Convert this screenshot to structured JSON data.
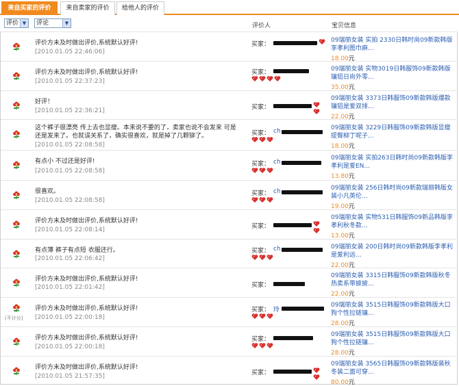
{
  "tabs": [
    {
      "label": "来自买家的评价",
      "active": true
    },
    {
      "label": "来自卖家的评价",
      "active": false
    },
    {
      "label": "给他人的评价",
      "active": false
    }
  ],
  "filters": {
    "rating_select": "评价",
    "comment_select": "评论"
  },
  "columns": {
    "reviewer": "评价人",
    "item": "宝贝信息"
  },
  "buyer_label": "买家：",
  "currency_unit": "元",
  "not_counted_label": "[不计分]",
  "colors": {
    "accent": "#f08a1e",
    "link": "#2a5db0",
    "heart": "#d8312f",
    "flower": "#d8312f",
    "stem": "#2e8b2e"
  },
  "rows": [
    {
      "comment": "评价方未及时做出评价,系统默认好评!",
      "date": "[2010.01.05 22:46:06]",
      "reviewer_prefix": "",
      "heart_count": 1,
      "item": "09瑞丽女装 实拍 2330日韩时尚09新款韩版李孝利图巾麻...",
      "price": "18.00"
    },
    {
      "comment": "评价方未及时做出评价,系统默认好评!",
      "date": "[2010.01.05 22:37:23]",
      "reviewer_prefix": "",
      "heart_count": 4,
      "item": "09瑞丽女装 实物3019日韩服饰09新款韩版镶铝日尚外零...",
      "price": "35.00"
    },
    {
      "comment": "好评！",
      "date": "[2010.01.05 22:36:21]",
      "reviewer_prefix": "",
      "heart_count": 2,
      "item": "09瑞丽女装 3373日韩服饰09新款韩版爆款镶铝是爱双排...",
      "price": "22.00"
    },
    {
      "comment": "这个裤子很漂亮 传上去也显瘦。本来说不要的了，卖家也说不会发来 可是还是发来了。也就误关系了，确实很喜欢，就是掉了几颗铆了。",
      "date": "[2010.01.05 22:08:58]",
      "reviewer_prefix": "ch",
      "heart_count": 3,
      "item": "09瑞丽女装 3229日韩服饰09新款韩版显瘦提臀柳丁呢子...",
      "price": "18.00"
    },
    {
      "comment": "有点小 不过还是好评!",
      "date": "[2010.01.05 22:08:58]",
      "reviewer_prefix": "ch",
      "heart_count": 3,
      "item": "09瑞丽女装 实拍263日韩时尚09新款韩版李孝利是爱EN...",
      "price": "13.80"
    },
    {
      "comment": "很喜欢。",
      "date": "[2010.01.05 22:08:58]",
      "reviewer_prefix": "ch",
      "heart_count": 3,
      "item": "09瑞丽女装 256日韩时尚09新款瑞丽韩版女装小凡英伦...",
      "price": "19.00"
    },
    {
      "comment": "评价方未及时做出评价,系统默认好评!",
      "date": "[2010.01.05 22:08:14]",
      "reviewer_prefix": "",
      "heart_count": 2,
      "item": "09瑞丽女装 实物531日韩服饰09新品韩版李孝利秋冬款...",
      "price": "13.00"
    },
    {
      "comment": "有点薄 裤子有点短 衣服还行。",
      "date": "[2010.01.05 22:06:42]",
      "reviewer_prefix": "ch",
      "heart_count": 3,
      "item": "09瑞丽女装 200日韩时尚09新款韩版李孝利是爱利远...",
      "price": "22.00"
    },
    {
      "comment": "评价方未及时做出评价,系统默认好评!",
      "date": "[2010.01.05 22:01:42]",
      "reviewer_prefix": "",
      "heart_count": 0,
      "item": "09瑞丽女装 3315日韩服饰09新款韩版秋冬热卖系带披披...",
      "price": "22.00"
    },
    {
      "comment": "评价方未及时做出评价,系统默认好评!",
      "date": "[2010.01.05 22:00:18]",
      "reviewer_prefix": "玲",
      "heart_count": 3,
      "item": "09瑞丽女装 3515日韩服饰09新款韩版大口狗个性拉链镶...",
      "price": "28.00",
      "not_counted": true
    },
    {
      "comment": "评价方未及时做出评价,系统默认好评!",
      "date": "[2010.01.05 22:00:18]",
      "reviewer_prefix": "",
      "heart_count": 3,
      "item": "09瑞丽女装 3515日韩服饰09新款韩版大口狗个性拉链镶...",
      "price": "28.00"
    },
    {
      "comment": "评价方未及时做出评价,系统默认好评!",
      "date": "[2010.01.05 21:57:35]",
      "reviewer_prefix": "",
      "heart_count": 2,
      "item": "09瑞丽女装 3565日韩服饰09新款韩版装秋冬装二面可穿...",
      "price": "80.00"
    }
  ]
}
